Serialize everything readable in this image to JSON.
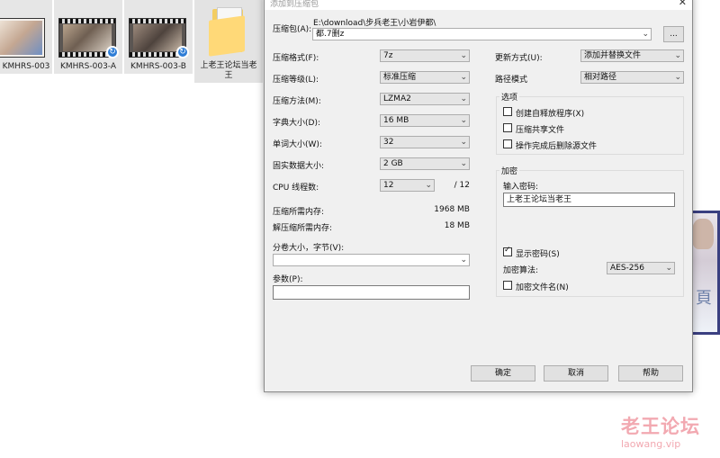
{
  "explorer": {
    "files": [
      {
        "name": "KMHRS-003"
      },
      {
        "name": "KMHRS-003-A"
      },
      {
        "name": "KMHRS-003-B"
      },
      {
        "name": "上老王论坛当老王"
      }
    ],
    "badge_icon": "sync-icon"
  },
  "dialog": {
    "title": "添加到压缩包",
    "close_glyph": "✕",
    "archive": {
      "label": "压缩包(A):",
      "path": "E:\\download\\步兵老王\\小岩伊都\\",
      "value": "都.7删z",
      "browse": "..."
    },
    "left": {
      "format": {
        "label": "压缩格式(F):",
        "value": "7z"
      },
      "level": {
        "label": "压缩等级(L):",
        "value": "标准压缩"
      },
      "method": {
        "label": "压缩方法(M):",
        "value": "LZMA2"
      },
      "dict": {
        "label": "字典大小(D):",
        "value": "16 MB"
      },
      "word": {
        "label": "单词大小(W):",
        "value": "32"
      },
      "solid": {
        "label": "固实数据大小:",
        "value": "2 GB"
      },
      "cpu": {
        "label": "CPU 线程数:",
        "value": "12",
        "max": "/ 12"
      },
      "mem_compress": {
        "label": "压缩所需内存:",
        "value": "1968 MB"
      },
      "mem_decompress": {
        "label": "解压缩所需内存:",
        "value": "18 MB"
      },
      "volume": {
        "label": "分卷大小，字节(V):",
        "value": ""
      },
      "params": {
        "label": "参数(P):",
        "value": ""
      }
    },
    "right": {
      "update": {
        "label": "更新方式(U):",
        "value": "添加并替换文件"
      },
      "pathmode": {
        "label": "路径模式",
        "value": "相对路径"
      },
      "options": {
        "title": "选项",
        "sfx": {
          "label": "创建自释放程序(X)",
          "checked": false
        },
        "shared": {
          "label": "压缩共享文件",
          "checked": false
        },
        "delete": {
          "label": "操作完成后删除源文件",
          "checked": false
        }
      },
      "encryption": {
        "title": "加密",
        "password_label": "输入密码:",
        "password": "上老王论坛当老王",
        "show": {
          "label": "显示密码(S)",
          "checked": true
        },
        "algo_label": "加密算法:",
        "algo": "AES-256",
        "encnames": {
          "label": "加密文件名(N)",
          "checked": false
        }
      }
    },
    "buttons": {
      "ok": "确定",
      "cancel": "取消",
      "help": "帮助"
    }
  },
  "watermark": {
    "cn": "老王论坛",
    "en": "laowang.vip"
  }
}
